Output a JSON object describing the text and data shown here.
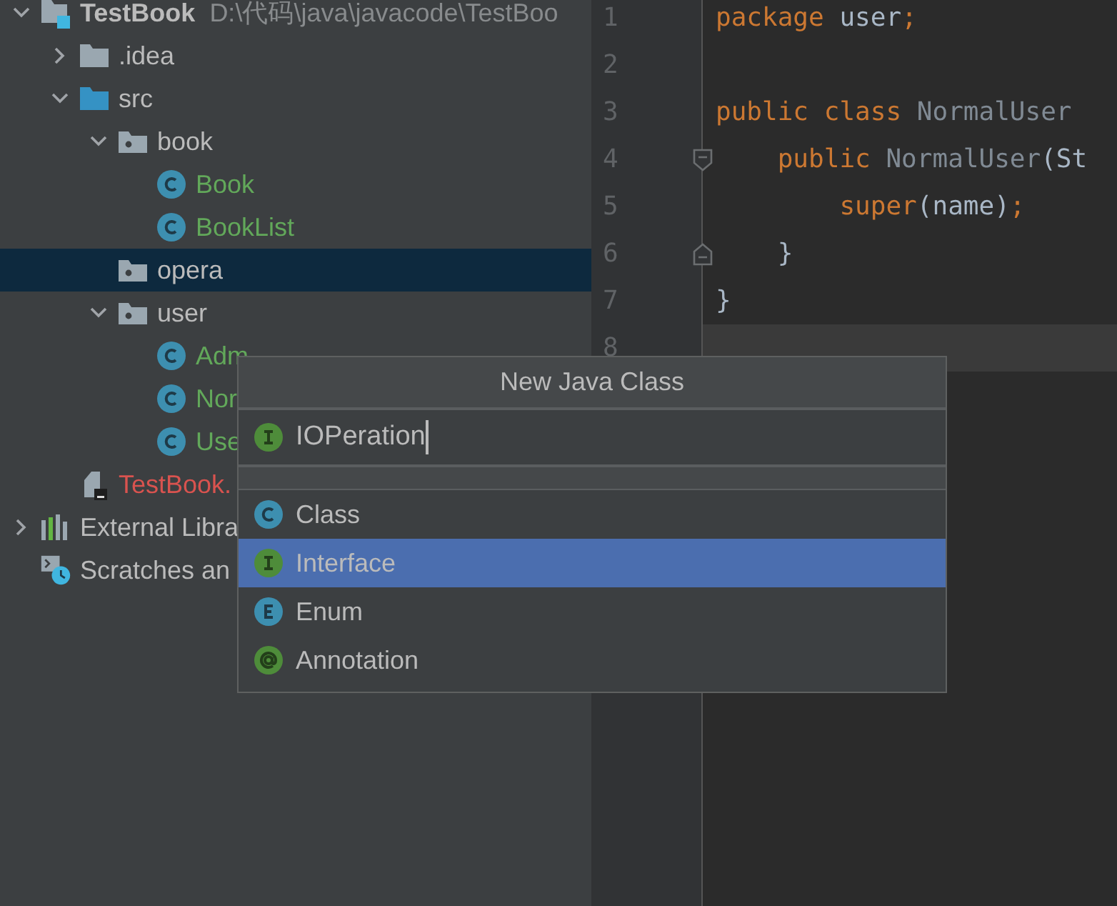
{
  "project_tree": [
    {
      "name": "TestBook",
      "path": "D:\\代码\\java\\javacode\\TestBoo",
      "kind": "project",
      "expanded": true,
      "selected": false,
      "color": "#bbbbbb",
      "children": [
        {
          "name": ".idea",
          "kind": "folder",
          "expanded": false,
          "selected": false,
          "color": "#bbbbbb"
        },
        {
          "name": "src",
          "kind": "source-folder",
          "expanded": true,
          "selected": false,
          "color": "#bbbbbb",
          "children": [
            {
              "name": "book",
              "kind": "package",
              "expanded": true,
              "selected": false,
              "color": "#bbbbbb",
              "children": [
                {
                  "name": "Book",
                  "kind": "class",
                  "selected": false,
                  "color": "#62a85a"
                },
                {
                  "name": "BookList",
                  "kind": "class",
                  "selected": false,
                  "color": "#62a85a"
                }
              ]
            },
            {
              "name": "opera",
              "kind": "package",
              "selected": true,
              "color": "#bbbbbb"
            },
            {
              "name": "user",
              "kind": "package",
              "expanded": true,
              "selected": false,
              "color": "#bbbbbb",
              "children": [
                {
                  "name": "Adm",
                  "kind": "class",
                  "selected": false,
                  "color": "#62a85a"
                },
                {
                  "name": "Nor",
                  "kind": "class",
                  "selected": false,
                  "color": "#62a85a"
                },
                {
                  "name": "Use",
                  "kind": "class",
                  "selected": false,
                  "color": "#62a85a"
                }
              ]
            }
          ]
        },
        {
          "name": "TestBook.",
          "kind": "module-file",
          "selected": false,
          "color": "#d9534f"
        }
      ]
    },
    {
      "name": "External Libra",
      "kind": "libraries",
      "expanded": false,
      "selected": false,
      "color": "#bbbbbb"
    },
    {
      "name": "Scratches an",
      "kind": "scratches",
      "selected": false,
      "color": "#bbbbbb"
    }
  ],
  "editor": {
    "lines": [
      {
        "number": "1",
        "kind": "plain",
        "current": false,
        "tokens": [
          {
            "kind": "keyword",
            "text": "package "
          },
          {
            "kind": "plain",
            "text": "user"
          },
          {
            "kind": "keyword",
            "text": ";"
          }
        ]
      },
      {
        "number": "2",
        "kind": "plain",
        "current": false
      },
      {
        "number": "3",
        "kind": "plain",
        "current": false,
        "tokens": [
          {
            "kind": "keyword",
            "text": "public class "
          },
          {
            "kind": "unused",
            "text": "NormalUser"
          }
        ]
      },
      {
        "number": "4",
        "kind": "fold-start",
        "current": false,
        "tokens": [
          {
            "kind": "keyword",
            "text": "    public "
          },
          {
            "kind": "unused",
            "text": "NormalUser"
          },
          {
            "kind": "plain",
            "text": "(St"
          }
        ]
      },
      {
        "number": "5",
        "kind": "plain",
        "current": false,
        "tokens": [
          {
            "kind": "keyword",
            "text": "        super"
          },
          {
            "kind": "plain",
            "text": "(name)"
          },
          {
            "kind": "keyword",
            "text": ";"
          }
        ]
      },
      {
        "number": "6",
        "kind": "fold-end",
        "current": false,
        "tokens": [
          {
            "kind": "plain",
            "text": "    }"
          }
        ]
      },
      {
        "number": "7",
        "kind": "plain",
        "current": false,
        "tokens": [
          {
            "kind": "plain",
            "text": "}"
          }
        ]
      },
      {
        "number": "8",
        "kind": "plain",
        "current": true
      }
    ]
  },
  "dialog": {
    "title": "New Java Class",
    "input": {
      "value": "IOPeration",
      "kind": "interface"
    },
    "options": [
      {
        "label": "Class",
        "kind": "class",
        "selected": false
      },
      {
        "label": "Interface",
        "kind": "interface",
        "selected": true
      },
      {
        "label": "Enum",
        "kind": "enum",
        "selected": false
      },
      {
        "label": "Annotation",
        "kind": "annotation",
        "selected": false
      }
    ]
  }
}
